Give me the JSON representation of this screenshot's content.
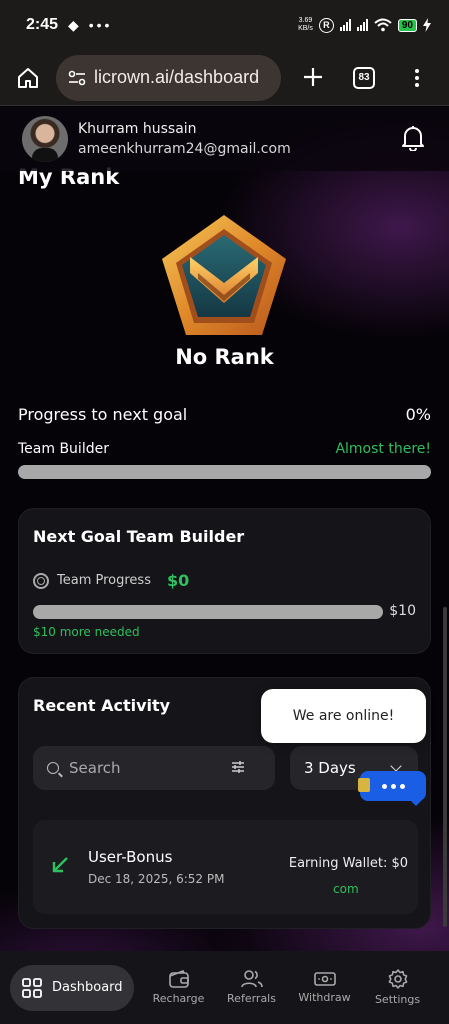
{
  "status_bar": {
    "time": "2:45",
    "left_icons": "◆ •••",
    "net_speed_value": "3.69",
    "net_speed_unit": "KB/s",
    "roaming": "R",
    "battery": "90"
  },
  "browser": {
    "url": "licrown.ai/dashboard",
    "tab_count": "83"
  },
  "user": {
    "name": "Khurram hussain",
    "email": "ameenkhurram24@gmail.com"
  },
  "rank": {
    "heading": "My Rank",
    "name": "No Rank"
  },
  "progress": {
    "title": "Progress to next goal",
    "percent_label": "0%",
    "percent": 0,
    "track_label": "Team Builder",
    "status": "Almost there!"
  },
  "goal_card": {
    "title": "Next Goal Team Builder",
    "team_progress_label": "Team Progress",
    "team_progress_value": "$0",
    "progress": 0,
    "target": "$10",
    "more_needed": "$10 more needed"
  },
  "activity": {
    "title": "Recent Activity",
    "search_placeholder": "Search",
    "days_selected": "3 Days",
    "items": [
      {
        "title": "User-Bonus",
        "date": "Dec 18, 2025, 6:52 PM",
        "wallet": "Earning Wallet: $0",
        "status": "com"
      }
    ]
  },
  "chat": {
    "bubble": "We are online!"
  },
  "nav": {
    "items": [
      {
        "label": "Dashboard",
        "icon": "grid-icon"
      },
      {
        "label": "Recharge",
        "icon": "wallet-icon"
      },
      {
        "label": "Referrals",
        "icon": "users-icon"
      },
      {
        "label": "Withdraw",
        "icon": "cash-icon"
      },
      {
        "label": "Settings",
        "icon": "gear-icon"
      }
    ]
  },
  "colors": {
    "accent_green": "#2fbf5f",
    "chat_blue": "#1b5ee6",
    "badge_gold": "#e8a23a",
    "badge_teal": "#1d4f5a"
  }
}
